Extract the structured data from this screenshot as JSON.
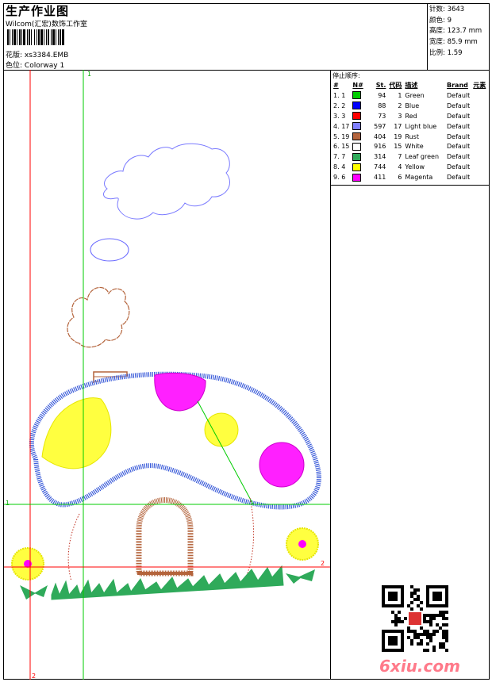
{
  "header": {
    "title": "生产作业图",
    "subtitle": "Wilcom(汇宏)数饰工作室",
    "pattern_label": "花版:",
    "pattern_value": "xs3384.EMB",
    "colorway_label": "色位:",
    "colorway_value": "Colorway 1"
  },
  "stats": {
    "stitches_label": "针数:",
    "stitches": "3643",
    "colors_label": "颜色:",
    "colors": "9",
    "height_label": "高度:",
    "height": "123.7 mm",
    "width_label": "宽度:",
    "width": "85.9 mm",
    "scale_label": "比例:",
    "scale": "1.59"
  },
  "stop_sequence": {
    "heading": "停止顺序:",
    "columns": [
      "#",
      "N#",
      "St.",
      "代码",
      "描述",
      "Brand",
      "元素"
    ],
    "rows": [
      {
        "idx": "1.",
        "n": "1",
        "st": "94",
        "code": "1",
        "desc": "Green",
        "brand": "Default",
        "color": "#00cc00"
      },
      {
        "idx": "2.",
        "n": "2",
        "st": "88",
        "code": "2",
        "desc": "Blue",
        "brand": "Default",
        "color": "#0000ff"
      },
      {
        "idx": "3.",
        "n": "3",
        "st": "73",
        "code": "3",
        "desc": "Red",
        "brand": "Default",
        "color": "#ff0000"
      },
      {
        "idx": "4.",
        "n": "17",
        "st": "597",
        "code": "17",
        "desc": "Light blue",
        "brand": "Default",
        "color": "#8080ff"
      },
      {
        "idx": "5.",
        "n": "19",
        "st": "404",
        "code": "19",
        "desc": "Rust",
        "brand": "Default",
        "color": "#b4643c"
      },
      {
        "idx": "6.",
        "n": "15",
        "st": "916",
        "code": "15",
        "desc": "White",
        "brand": "Default",
        "color": "#ffffff"
      },
      {
        "idx": "7.",
        "n": "7",
        "st": "314",
        "code": "7",
        "desc": "Leaf green",
        "brand": "Default",
        "color": "#2faa5a"
      },
      {
        "idx": "8.",
        "n": "4",
        "st": "744",
        "code": "4",
        "desc": "Yellow",
        "brand": "Default",
        "color": "#ffff00"
      },
      {
        "idx": "9.",
        "n": "6",
        "st": "411",
        "code": "6",
        "desc": "Magenta",
        "brand": "Default",
        "color": "#ff00ff"
      }
    ]
  },
  "axes": {
    "v_top": "1",
    "v_bottom": "2",
    "h_left": "1",
    "h_right": "2"
  },
  "watermark": "6xiu.com"
}
